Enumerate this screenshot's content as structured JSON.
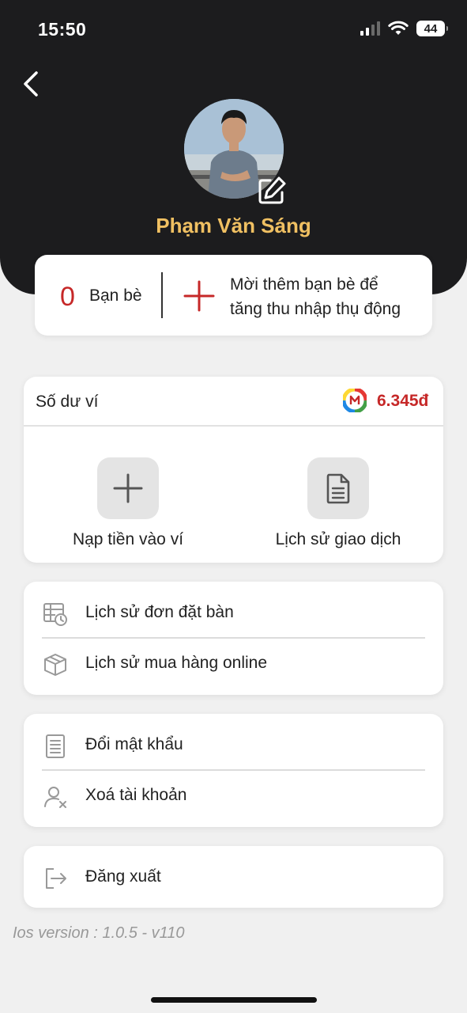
{
  "status_bar": {
    "time": "15:50",
    "battery": "44",
    "icons": [
      "signal-icon",
      "wifi-icon",
      "battery-icon"
    ]
  },
  "header": {
    "back_icon": "chevron-left-icon",
    "avatar": "user-avatar-photo",
    "edit_icon": "edit-icon",
    "name": "Phạm Văn Sáng"
  },
  "friends": {
    "count": "0",
    "label": "Bạn bè",
    "invite_icon": "plus-icon",
    "invite_line1": "Mời thêm bạn bè để",
    "invite_line2": "tăng thu nhập thụ động"
  },
  "wallet": {
    "label": "Số dư ví",
    "logo_icon": "wallet-m-logo-icon",
    "balance": "6.345đ",
    "actions": [
      {
        "label": "Nạp tiền vào ví",
        "icon": "plus-icon"
      },
      {
        "label": "Lịch sử giao dịch",
        "icon": "document-icon"
      }
    ]
  },
  "menu_groups": [
    [
      {
        "label": "Lịch sử đơn đặt bàn",
        "icon": "table-clock-icon"
      },
      {
        "label": "Lịch sử mua hàng online",
        "icon": "package-box-icon"
      }
    ],
    [
      {
        "label": "Đổi mật khẩu",
        "icon": "document-lines-icon"
      },
      {
        "label": "Xoá tài khoản",
        "icon": "user-remove-icon"
      }
    ],
    [
      {
        "label": "Đăng xuất",
        "icon": "logout-icon"
      }
    ]
  ],
  "version": "Ios version : 1.0.5 - v110",
  "colors": {
    "header_bg": "#1c1c1e",
    "name": "#f0c062",
    "accent_red": "#c62828",
    "page_bg": "#f0f0f0"
  }
}
